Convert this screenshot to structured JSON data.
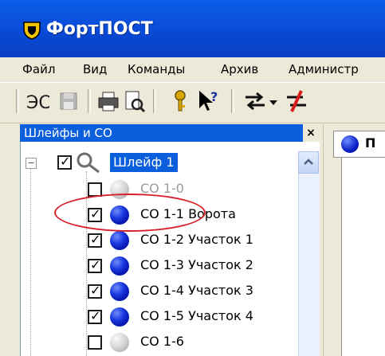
{
  "window": {
    "title": "ФортПОСТ"
  },
  "menu": {
    "items": [
      "Файл",
      "Вид",
      "Команды",
      "Архив",
      "Администр"
    ]
  },
  "toolbar": {
    "buttons": [
      "connect-icon",
      "save-icon",
      "print-icon",
      "print-preview-icon",
      "key-icon",
      "help-pointer-icon",
      "swap-icon",
      "dropdown-icon",
      "disconnect-icon"
    ]
  },
  "panel": {
    "title": "Шлейфы и СО",
    "close": "×"
  },
  "right_tab": {
    "label": "П"
  },
  "tree": {
    "root": {
      "label": "Шлейф 1",
      "expander": "−",
      "checked": true
    },
    "items": [
      {
        "label": "СО 1-0",
        "checked": false,
        "state": "grey"
      },
      {
        "label": "СО 1-1 Ворота",
        "checked": true,
        "state": "blue"
      },
      {
        "label": "СО 1-2 Участок 1",
        "checked": true,
        "state": "blue"
      },
      {
        "label": "СО 1-3 Участок 2",
        "checked": true,
        "state": "blue"
      },
      {
        "label": "СО 1-4 Участок 3",
        "checked": true,
        "state": "blue"
      },
      {
        "label": "СО 1-5 Участок 4",
        "checked": true,
        "state": "blue"
      },
      {
        "label": "СО 1-6",
        "checked": false,
        "state": "grey"
      }
    ]
  },
  "colors": {
    "titlebar": "#0b52df",
    "selection": "#0b5fdd",
    "annotation": "#d8202a"
  }
}
